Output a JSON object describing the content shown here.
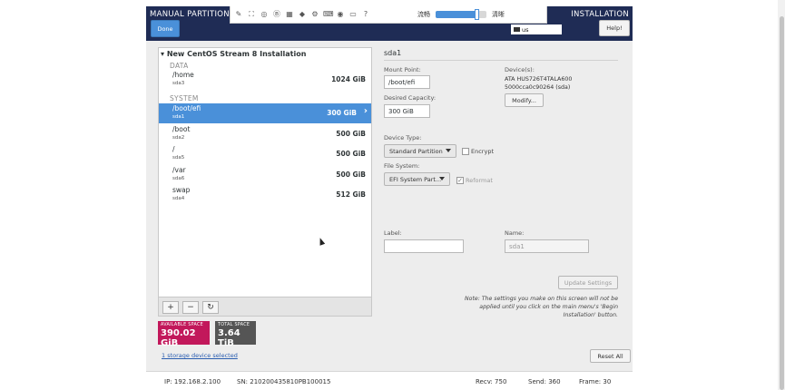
{
  "header": {
    "title": "MANUAL PARTITIONING",
    "title_right": "INSTALLATION",
    "done_label": "Done",
    "keyboard": "us",
    "help_label": "Help!"
  },
  "toolbar": {
    "icons": [
      "pin-icon",
      "fullscreen-icon",
      "circle-icon",
      "bold-b-icon",
      "grid-icon",
      "tag-icon",
      "gear-icon",
      "keyboard-icon",
      "record-icon",
      "display-icon",
      "help-icon"
    ],
    "left_label": "流畅",
    "right_label": "清晰",
    "slider_level": 0.82
  },
  "tree": {
    "root_label": "New CentOS Stream 8 Installation",
    "groups": [
      {
        "label": "DATA"
      },
      {
        "label": "SYSTEM"
      }
    ],
    "mounts": [
      {
        "name": "/home",
        "device": "sda3",
        "size": "1024 GiB"
      },
      {
        "name": "/boot/efi",
        "device": "sda1",
        "size": "300 GiB",
        "selected": true
      },
      {
        "name": "/boot",
        "device": "sda2",
        "size": "500 GiB"
      },
      {
        "name": "/",
        "device": "sda5",
        "size": "500 GiB"
      },
      {
        "name": "/var",
        "device": "sda6",
        "size": "500 GiB"
      },
      {
        "name": "swap",
        "device": "sda4",
        "size": "512 GiB"
      }
    ]
  },
  "buttons": {
    "add": "+",
    "remove": "−",
    "refresh": "↻"
  },
  "space": {
    "available_label": "AVAILABLE SPACE",
    "available_value": "390.02 GiB",
    "available_color": "#c2185b",
    "total_label": "TOTAL SPACE",
    "total_value": "3.64 TiB",
    "total_color": "#555555"
  },
  "storage_link": "1 storage device selected",
  "details": {
    "title": "sda1",
    "mount_point_label": "Mount Point:",
    "mount_point_value": "/boot/efi",
    "desired_capacity_label": "Desired Capacity:",
    "desired_capacity_value": "300 GiB",
    "devices_label": "Device(s):",
    "device_line1": "ATA HUS726T4TALA600",
    "device_line2": "5000cca0c90264 (sda)",
    "modify_label": "Modify...",
    "device_type_label": "Device Type:",
    "device_type_value": "Standard Partition",
    "encrypt_label": "Encrypt",
    "file_system_label": "File System:",
    "file_system_value": "EFI System Part...",
    "reformat_label": "Reformat",
    "label_label": "Label:",
    "label_value": "",
    "name_label": "Name:",
    "name_value": "sda1",
    "update_label": "Update Settings",
    "note": "Note:  The settings you make on this screen will not be applied until you click on the main menu's 'Begin Installation' button.",
    "reset_label": "Reset All"
  },
  "status": {
    "ip": "IP: 192.168.2.100",
    "sn": "SN: 210200435810PB100015",
    "recv": "Recv: 750",
    "send": "Send: 360",
    "frame": "Frame: 30"
  }
}
